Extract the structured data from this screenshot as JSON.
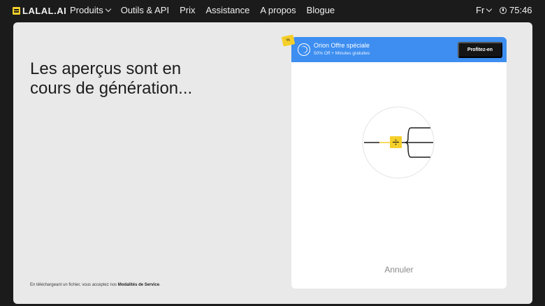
{
  "nav": {
    "logo": "LALAL.AI",
    "items": [
      {
        "label": "Produits",
        "has_dropdown": true
      },
      {
        "label": "Outils & API",
        "has_dropdown": false
      },
      {
        "label": "Prix",
        "has_dropdown": false
      },
      {
        "label": "Assistance",
        "has_dropdown": false
      },
      {
        "label": "A propos",
        "has_dropdown": false
      },
      {
        "label": "Blogue",
        "has_dropdown": false
      }
    ],
    "language": "Fr",
    "credits": "75:46"
  },
  "main": {
    "headline_line1": "Les aperçus sont en",
    "headline_line2": "cours de génération...",
    "terms_prefix": "En téléchargeant un fichier, vous acceptez nos ",
    "terms_link": "Modalités de Service",
    "terms_suffix": "."
  },
  "card": {
    "promo_tag": "%",
    "promo_title": "Orion Offre spéciale",
    "promo_subtitle": "50% Off + Minutes gratuites",
    "promo_button": "Profitez-en",
    "cancel_label": "Annuler"
  },
  "colors": {
    "accent_blue": "#3d8ef0",
    "brand_yellow": "#f5cf2a",
    "panel_bg": "#e9e9e9",
    "dark_bg": "#1b1b1b"
  }
}
